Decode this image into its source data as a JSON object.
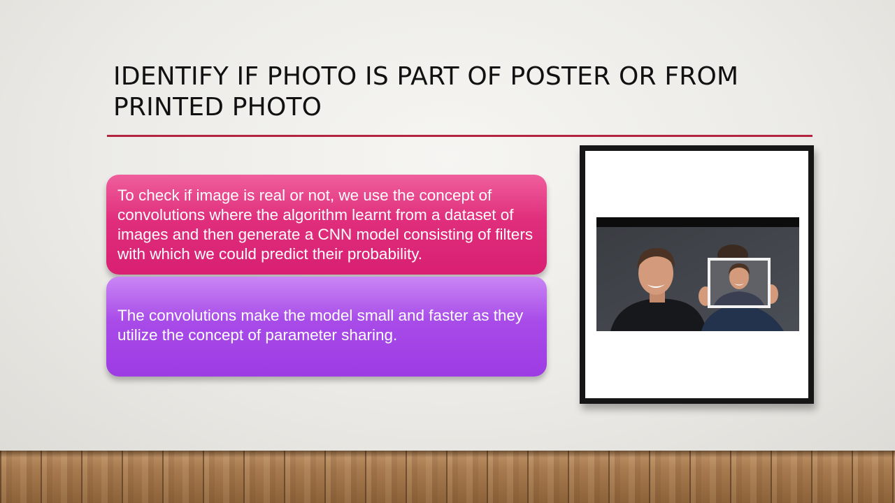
{
  "slide": {
    "title": "IDENTIFY IF PHOTO IS PART OF POSTER OR FROM PRINTED PHOTO",
    "accent_color": "#b3243e",
    "boxes": [
      {
        "text": "To check if image is real or not, we use the concept of convolutions where the algorithm learnt from a dataset of images and then generate a CNN model consisting of filters with which we could predict their probability.",
        "color": "#e02e7c"
      },
      {
        "text": "The convolutions make the model small and faster as they utilize the concept of parameter sharing.",
        "color": "#a84be8"
      }
    ],
    "picture": {
      "description_icon": "photo-of-two-men-holding-printed-photo"
    }
  }
}
